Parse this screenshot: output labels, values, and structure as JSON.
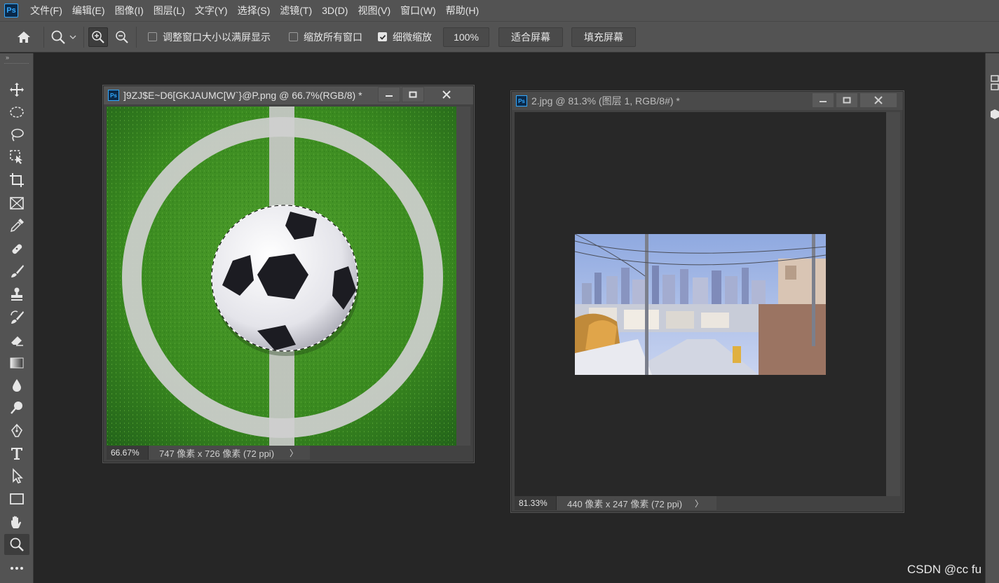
{
  "app": {
    "logo_text": "Ps"
  },
  "menu": [
    "文件(F)",
    "编辑(E)",
    "图像(I)",
    "图层(L)",
    "文字(Y)",
    "选择(S)",
    "滤镜(T)",
    "3D(D)",
    "视图(V)",
    "窗口(W)",
    "帮助(H)"
  ],
  "options": {
    "resize_windows_label": "调整窗口大小以满屏显示",
    "resize_windows_checked": false,
    "zoom_all_windows_label": "缩放所有窗口",
    "zoom_all_windows_checked": false,
    "scrubby_zoom_label": "细微缩放",
    "scrubby_zoom_checked": true,
    "zoom_value": "100%",
    "fit_screen_label": "适合屏幕",
    "fill_screen_label": "填充屏幕"
  },
  "toolbar": {
    "collapse_glyph": "»",
    "tools": [
      "move-tool",
      "marquee-tool",
      "lasso-tool",
      "object-selection-tool",
      "crop-tool",
      "frame-tool",
      "eyedropper-tool",
      "healing-tool",
      "brush-tool",
      "stamp-tool",
      "history-brush-tool",
      "eraser-tool",
      "gradient-tool",
      "blur-tool",
      "dodge-tool",
      "pen-tool",
      "type-tool",
      "path-selection-tool",
      "rectangle-tool",
      "hand-tool",
      "zoom-tool",
      "more-tools"
    ],
    "active_tool": "zoom-tool"
  },
  "documents": [
    {
      "title": "]9ZJ$E~D6[GKJAUMC[W`}@P.png @ 66.7%(RGB/8) *",
      "zoom": "66.67%",
      "info": "747 像素 x 726 像素 (72 ppi)",
      "arrow": "〉",
      "active": true
    },
    {
      "title": "2.jpg @ 81.3% (图层 1, RGB/8#) *",
      "zoom": "81.33%",
      "info": "440 像素 x 247 像素 (72 ppi)",
      "arrow": "〉",
      "active": false
    }
  ],
  "watermark": "CSDN @cc fu"
}
